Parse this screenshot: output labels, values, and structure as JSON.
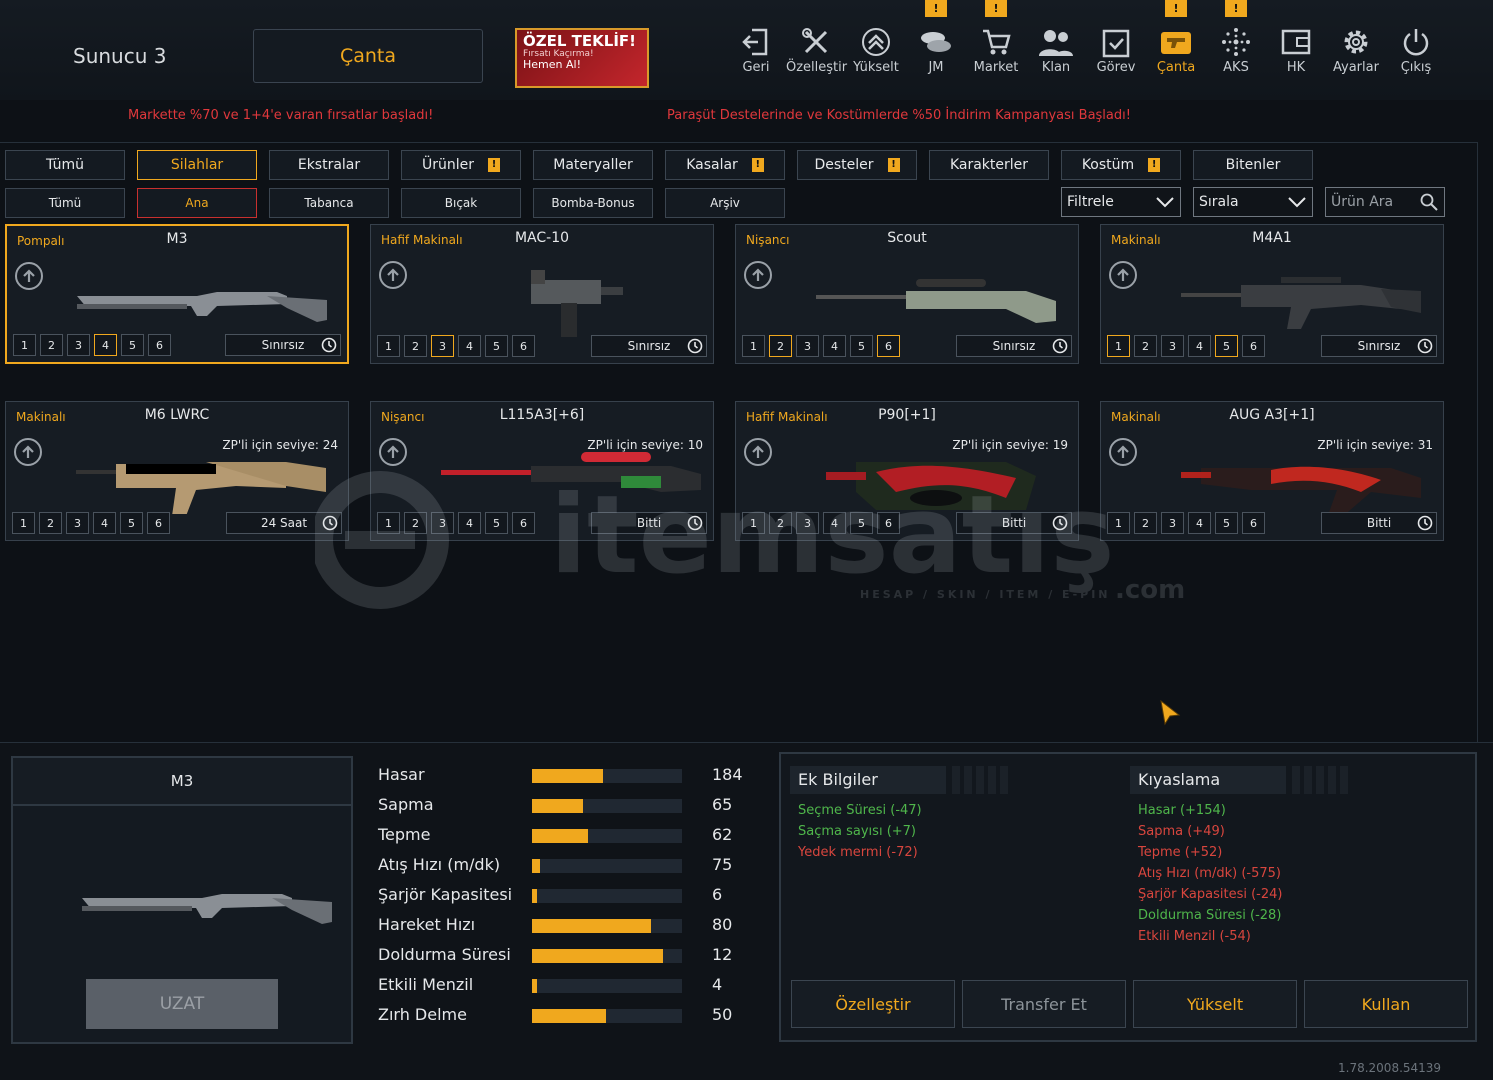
{
  "server": "Sunucu 3",
  "page_title": "Çanta",
  "offer": {
    "title": "ÖZEL TEKLİF!",
    "sub": "Fırsatı Kaçırma!",
    "cta": "Hemen Al!"
  },
  "nav": [
    {
      "label": "Geri",
      "icon": "back-icon",
      "badge": ""
    },
    {
      "label": "Özelleştir",
      "icon": "tools-icon",
      "badge": ""
    },
    {
      "label": "Yükselt",
      "icon": "upgrade-icon",
      "badge": ""
    },
    {
      "label": "JM",
      "icon": "coins-icon",
      "badge": "!"
    },
    {
      "label": "Market",
      "icon": "cart-icon",
      "badge": "!"
    },
    {
      "label": "Klan",
      "icon": "clan-icon",
      "badge": ""
    },
    {
      "label": "Görev",
      "icon": "mission-icon",
      "badge": ""
    },
    {
      "label": "Çanta",
      "icon": "gun-icon",
      "badge": "!"
    },
    {
      "label": "AKS",
      "icon": "aks-icon",
      "badge": "!"
    },
    {
      "label": "HK",
      "icon": "wallet-icon",
      "badge": ""
    },
    {
      "label": "Ayarlar",
      "icon": "gear-icon",
      "badge": ""
    },
    {
      "label": "Çıkış",
      "icon": "power-icon",
      "badge": ""
    }
  ],
  "ticker_left": "Markette %70 ve 1+4'e varan fırsatlar başladı!",
  "ticker_right": "Paraşüt Destelerinde ve Kostümlerde %50 İndirim Kampanyası Başladı!",
  "tabs": [
    "Tümü",
    "Silahlar",
    "Ekstralar",
    "Ürünler",
    "Materyaller",
    "Kasalar",
    "Desteler",
    "Karakterler",
    "Kostüm",
    "Bitenler"
  ],
  "subtabs": [
    "Tümü",
    "Ana",
    "Tabanca",
    "Bıçak",
    "Bomba-Bonus",
    "Arşiv"
  ],
  "filter": "Filtrele",
  "sort": "Sırala",
  "search_placeholder": "Ürün Ara",
  "cards": [
    {
      "cat": "Pompalı",
      "name": "M3",
      "zp": "",
      "dur": "Sınırsız"
    },
    {
      "cat": "Hafif Makinalı",
      "name": "MAC-10",
      "zp": "",
      "dur": "Sınırsız"
    },
    {
      "cat": "Nişancı",
      "name": "Scout",
      "zp": "",
      "dur": "Sınırsız"
    },
    {
      "cat": "Makinalı",
      "name": "M4A1",
      "zp": "",
      "dur": "Sınırsız"
    },
    {
      "cat": "Makinalı",
      "name": "M6 LWRC",
      "zp": "ZP'li için seviye: 24",
      "dur": "24 Saat"
    },
    {
      "cat": "Nişancı",
      "name": "L115A3[+6]",
      "zp": "ZP'li için seviye: 10",
      "dur": "Bitti"
    },
    {
      "cat": "Hafif Makinalı",
      "name": "P90[+1]",
      "zp": "ZP'li için seviye: 19",
      "dur": "Bitti"
    },
    {
      "cat": "Makinalı",
      "name": "AUG A3[+1]",
      "zp": "ZP'li için seviye: 31",
      "dur": "Bitti"
    }
  ],
  "slot_numbers": [
    "1",
    "2",
    "3",
    "4",
    "5",
    "6"
  ],
  "selected": {
    "name": "M3",
    "extend": "UZAT"
  },
  "stats": [
    {
      "label": "Hasar",
      "value": "184",
      "level": 0.47
    },
    {
      "label": "Sapma",
      "value": "65",
      "level": 0.34
    },
    {
      "label": "Tepme",
      "value": "62",
      "level": 0.37
    },
    {
      "label": "Atış Hızı (m/dk)",
      "value": "75",
      "level": 0.05
    },
    {
      "label": "Şarjör Kapasitesi",
      "value": "6",
      "level": 0.03
    },
    {
      "label": "Hareket Hızı",
      "value": "80",
      "level": 0.79
    },
    {
      "label": "Doldurma Süresi",
      "value": "12",
      "level": 0.87
    },
    {
      "label": "Etkili Menzil",
      "value": "4",
      "level": 0.03
    },
    {
      "label": "Zırh Delme",
      "value": "50",
      "level": 0.49
    }
  ],
  "extra_title": "Ek Bilgiler",
  "extra": [
    {
      "text": "Seçme Süresi (-47)",
      "good": true
    },
    {
      "text": "Saçma sayısı (+7)",
      "good": true
    },
    {
      "text": "Yedek mermi (-72)",
      "good": false
    }
  ],
  "compare_title": "Kıyaslama",
  "compare": [
    {
      "text": "Hasar (+154)",
      "good": true
    },
    {
      "text": "Sapma (+49)",
      "good": false
    },
    {
      "text": "Tepme (+52)",
      "good": false
    },
    {
      "text": "Atış Hızı (m/dk) (-575)",
      "good": false
    },
    {
      "text": "Şarjör Kapasitesi (-24)",
      "good": false
    },
    {
      "text": "Doldurma Süresi (-28)",
      "good": true
    },
    {
      "text": "Etkili Menzil (-54)",
      "good": false
    }
  ],
  "actions": [
    "Özelleştir",
    "Transfer Et",
    "Yükselt",
    "Kullan"
  ],
  "watermark": {
    "brand": "itemsatış",
    "domain": ".com",
    "tagline": "HESAP / SKIN / ITEM / E-PIN"
  },
  "version": "1.78.2008.54139",
  "colors": {
    "accent": "#f0a81e",
    "alert": "#e0383c",
    "good": "#4fb64b",
    "bad": "#d8463e"
  }
}
